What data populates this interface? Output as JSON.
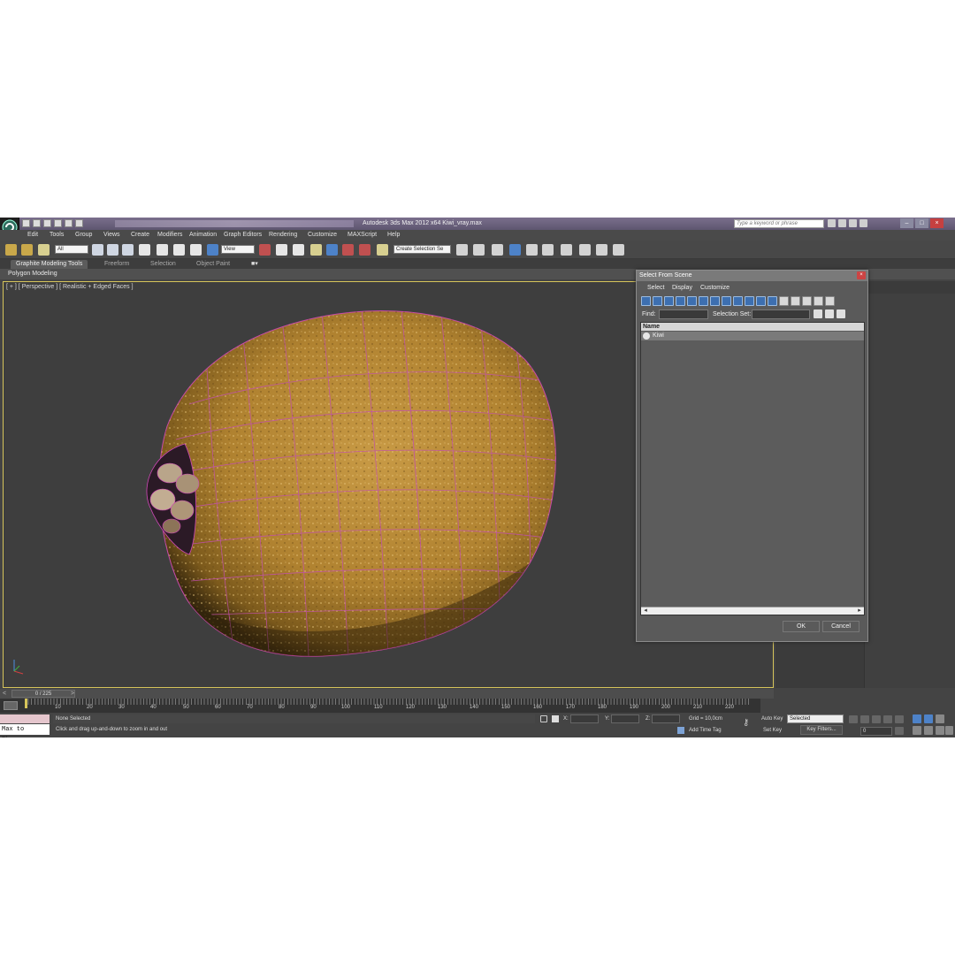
{
  "window": {
    "title": "Autodesk 3ds Max  2012 x64      Kiwi_vray.max",
    "search_placeholder": "Type a keyword or phrase"
  },
  "menu": [
    "Edit",
    "Tools",
    "Group",
    "Views",
    "Create",
    "Modifiers",
    "Animation",
    "Graph Editors",
    "Rendering",
    "Customize",
    "MAXScript",
    "Help"
  ],
  "toolbar": {
    "selection_filter": "All",
    "ref_coord": "View",
    "named_selection": "Create Selection Se"
  },
  "ribbon": {
    "tabs": [
      "Graphite Modeling Tools",
      "Freeform",
      "Selection",
      "Object Paint"
    ],
    "panel": "Polygon Modeling"
  },
  "viewport": {
    "label": "[ + ] [ Perspective ] [ Realistic + Edged Faces ]",
    "object_name": "Kiwi"
  },
  "dialog": {
    "title": "Select From Scene",
    "menu": [
      "Select",
      "Display",
      "Customize"
    ],
    "find_label": "Find:",
    "selection_set_label": "Selection Set:",
    "column_name": "Name",
    "items": [
      "Kiwi"
    ],
    "ok": "OK",
    "cancel": "Cancel"
  },
  "timeline": {
    "frame": "0 / 225",
    "ticks": [
      "10",
      "20",
      "30",
      "40",
      "50",
      "60",
      "70",
      "80",
      "90",
      "100",
      "110",
      "120",
      "130",
      "140",
      "150",
      "160",
      "170",
      "180",
      "190",
      "200",
      "210",
      "220"
    ]
  },
  "status": {
    "script": "Max to Physc.",
    "selection": "None Selected",
    "prompt": "Click and drag up-and-down to zoom in and out",
    "x_label": "X:",
    "y_label": "Y:",
    "z_label": "Z:",
    "grid": "Grid = 10,0cm",
    "add_time_tag": "Add Time Tag",
    "auto_key": "Auto Key",
    "set_key": "Set Key",
    "key_mode": "Selected",
    "key_filters": "Key Filters...",
    "frame_value": "0"
  },
  "colors": {
    "accent_selection": "#d6c45a",
    "mesh_wire": "#d048b8",
    "kiwi_skin": "#b88a33",
    "title_bar": "#6b6080"
  }
}
